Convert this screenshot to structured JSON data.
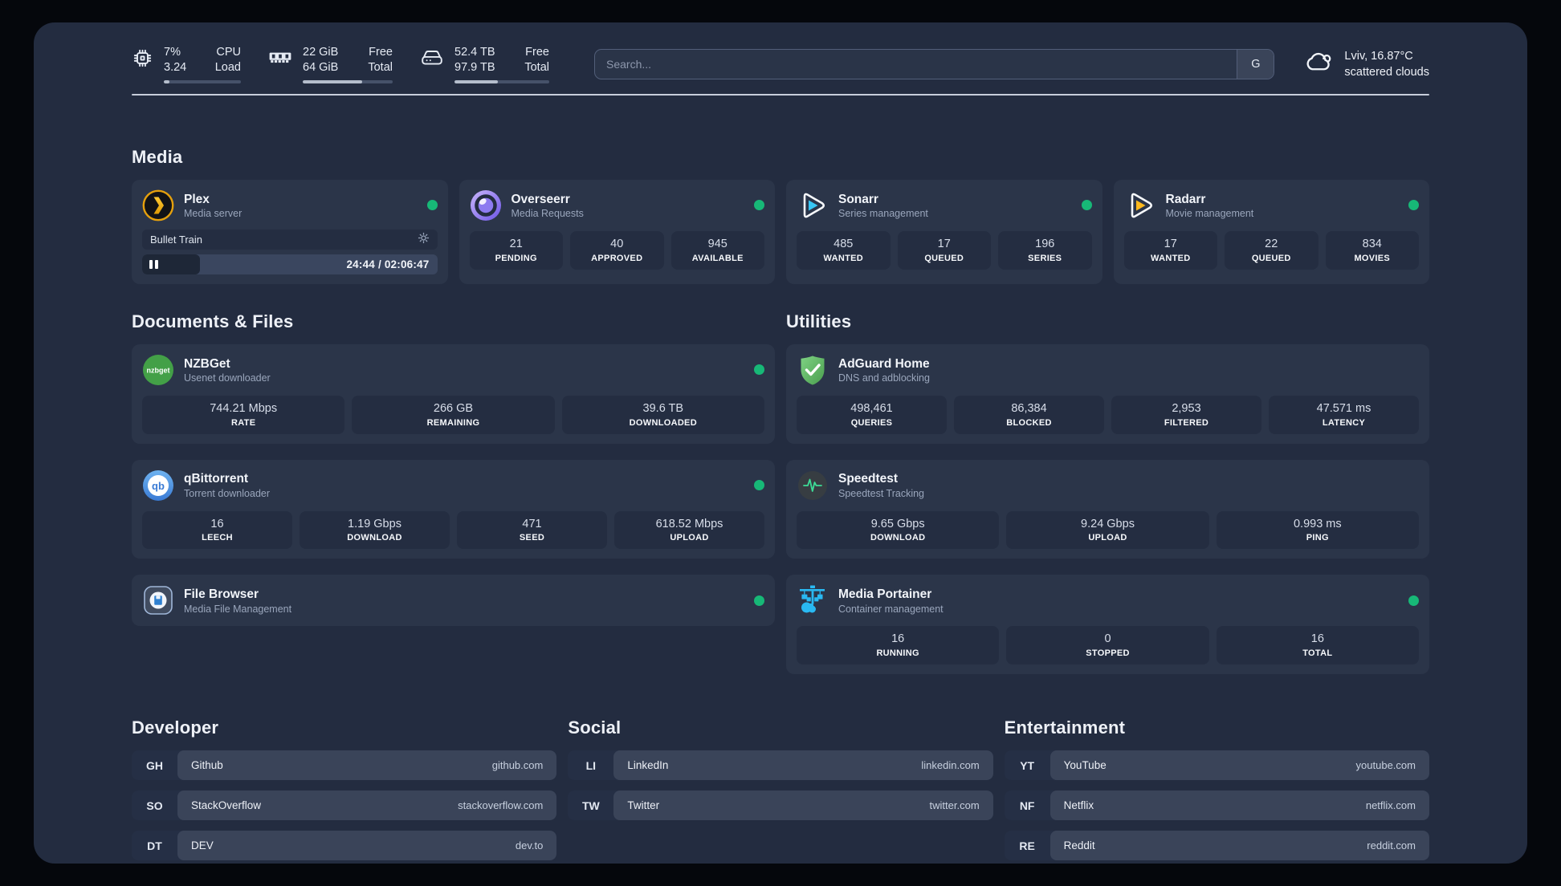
{
  "colors": {
    "status_online": "#17b877",
    "plex_accent": "#e5a00d",
    "sonarr_accent": "#38c6f4",
    "radarr_accent": "#ffb91e",
    "adguard_accent": "#5cb860",
    "portainer_accent": "#29b9f2",
    "speedtest_accent": "#3ddc97"
  },
  "header": {
    "cpu": {
      "values": [
        "7%",
        "3.24"
      ],
      "labels": [
        "CPU",
        "Load"
      ],
      "progress_pct": 7
    },
    "memory": {
      "values": [
        "22 GiB",
        "64 GiB"
      ],
      "labels": [
        "Free",
        "Total"
      ],
      "progress_pct": 66
    },
    "disk": {
      "values": [
        "52.4 TB",
        "97.9 TB"
      ],
      "labels": [
        "Free",
        "Total"
      ],
      "progress_pct": 46
    },
    "search": {
      "placeholder": "Search...",
      "engine_button": "G"
    },
    "weather": {
      "location": "Lviv, 16.87°C",
      "condition": "scattered clouds"
    }
  },
  "sections": {
    "media": "Media",
    "documents": "Documents & Files",
    "utilities": "Utilities",
    "developer": "Developer",
    "social": "Social",
    "entertainment": "Entertainment"
  },
  "apps": {
    "plex": {
      "name": "Plex",
      "description": "Media server",
      "player": {
        "title": "Bullet Train",
        "time": "24:44 / 02:06:47",
        "progress_pct": 19.5
      }
    },
    "overseerr": {
      "name": "Overseerr",
      "description": "Media Requests",
      "stats": [
        {
          "value": "21",
          "label": "PENDING"
        },
        {
          "value": "40",
          "label": "APPROVED"
        },
        {
          "value": "945",
          "label": "AVAILABLE"
        }
      ]
    },
    "sonarr": {
      "name": "Sonarr",
      "description": "Series management",
      "stats": [
        {
          "value": "485",
          "label": "WANTED"
        },
        {
          "value": "17",
          "label": "QUEUED"
        },
        {
          "value": "196",
          "label": "SERIES"
        }
      ]
    },
    "radarr": {
      "name": "Radarr",
      "description": "Movie management",
      "stats": [
        {
          "value": "17",
          "label": "WANTED"
        },
        {
          "value": "22",
          "label": "QUEUED"
        },
        {
          "value": "834",
          "label": "MOVIES"
        }
      ]
    },
    "nzbget": {
      "name": "NZBGet",
      "description": "Usenet downloader",
      "icon_text": "nzbget",
      "stats": [
        {
          "value": "744.21 Mbps",
          "label": "RATE"
        },
        {
          "value": "266 GB",
          "label": "REMAINING"
        },
        {
          "value": "39.6 TB",
          "label": "DOWNLOADED"
        }
      ]
    },
    "qbittorrent": {
      "name": "qBittorrent",
      "description": "Torrent downloader",
      "icon_text": "qb",
      "stats": [
        {
          "value": "16",
          "label": "LEECH"
        },
        {
          "value": "1.19 Gbps",
          "label": "DOWNLOAD"
        },
        {
          "value": "471",
          "label": "SEED"
        },
        {
          "value": "618.52 Mbps",
          "label": "UPLOAD"
        }
      ]
    },
    "filebrowser": {
      "name": "File Browser",
      "description": "Media File Management"
    },
    "adguard": {
      "name": "AdGuard Home",
      "description": "DNS and adblocking",
      "stats": [
        {
          "value": "498,461",
          "label": "QUERIES"
        },
        {
          "value": "86,384",
          "label": "BLOCKED"
        },
        {
          "value": "2,953",
          "label": "FILTERED"
        },
        {
          "value": "47.571 ms",
          "label": "LATENCY"
        }
      ]
    },
    "speedtest": {
      "name": "Speedtest",
      "description": "Speedtest Tracking",
      "stats": [
        {
          "value": "9.65 Gbps",
          "label": "DOWNLOAD"
        },
        {
          "value": "9.24 Gbps",
          "label": "UPLOAD"
        },
        {
          "value": "0.993 ms",
          "label": "PING"
        }
      ]
    },
    "portainer": {
      "name": "Media Portainer",
      "description": "Container management",
      "stats": [
        {
          "value": "16",
          "label": "RUNNING"
        },
        {
          "value": "0",
          "label": "STOPPED"
        },
        {
          "value": "16",
          "label": "TOTAL"
        }
      ]
    }
  },
  "bookmarks": {
    "developer": [
      {
        "abbr": "GH",
        "name": "Github",
        "url": "github.com"
      },
      {
        "abbr": "SO",
        "name": "StackOverflow",
        "url": "stackoverflow.com"
      },
      {
        "abbr": "DT",
        "name": "DEV",
        "url": "dev.to"
      }
    ],
    "social": [
      {
        "abbr": "LI",
        "name": "LinkedIn",
        "url": "linkedin.com"
      },
      {
        "abbr": "TW",
        "name": "Twitter",
        "url": "twitter.com"
      }
    ],
    "entertainment": [
      {
        "abbr": "YT",
        "name": "YouTube",
        "url": "youtube.com"
      },
      {
        "abbr": "NF",
        "name": "Netflix",
        "url": "netflix.com"
      },
      {
        "abbr": "RE",
        "name": "Reddit",
        "url": "reddit.com"
      }
    ]
  }
}
